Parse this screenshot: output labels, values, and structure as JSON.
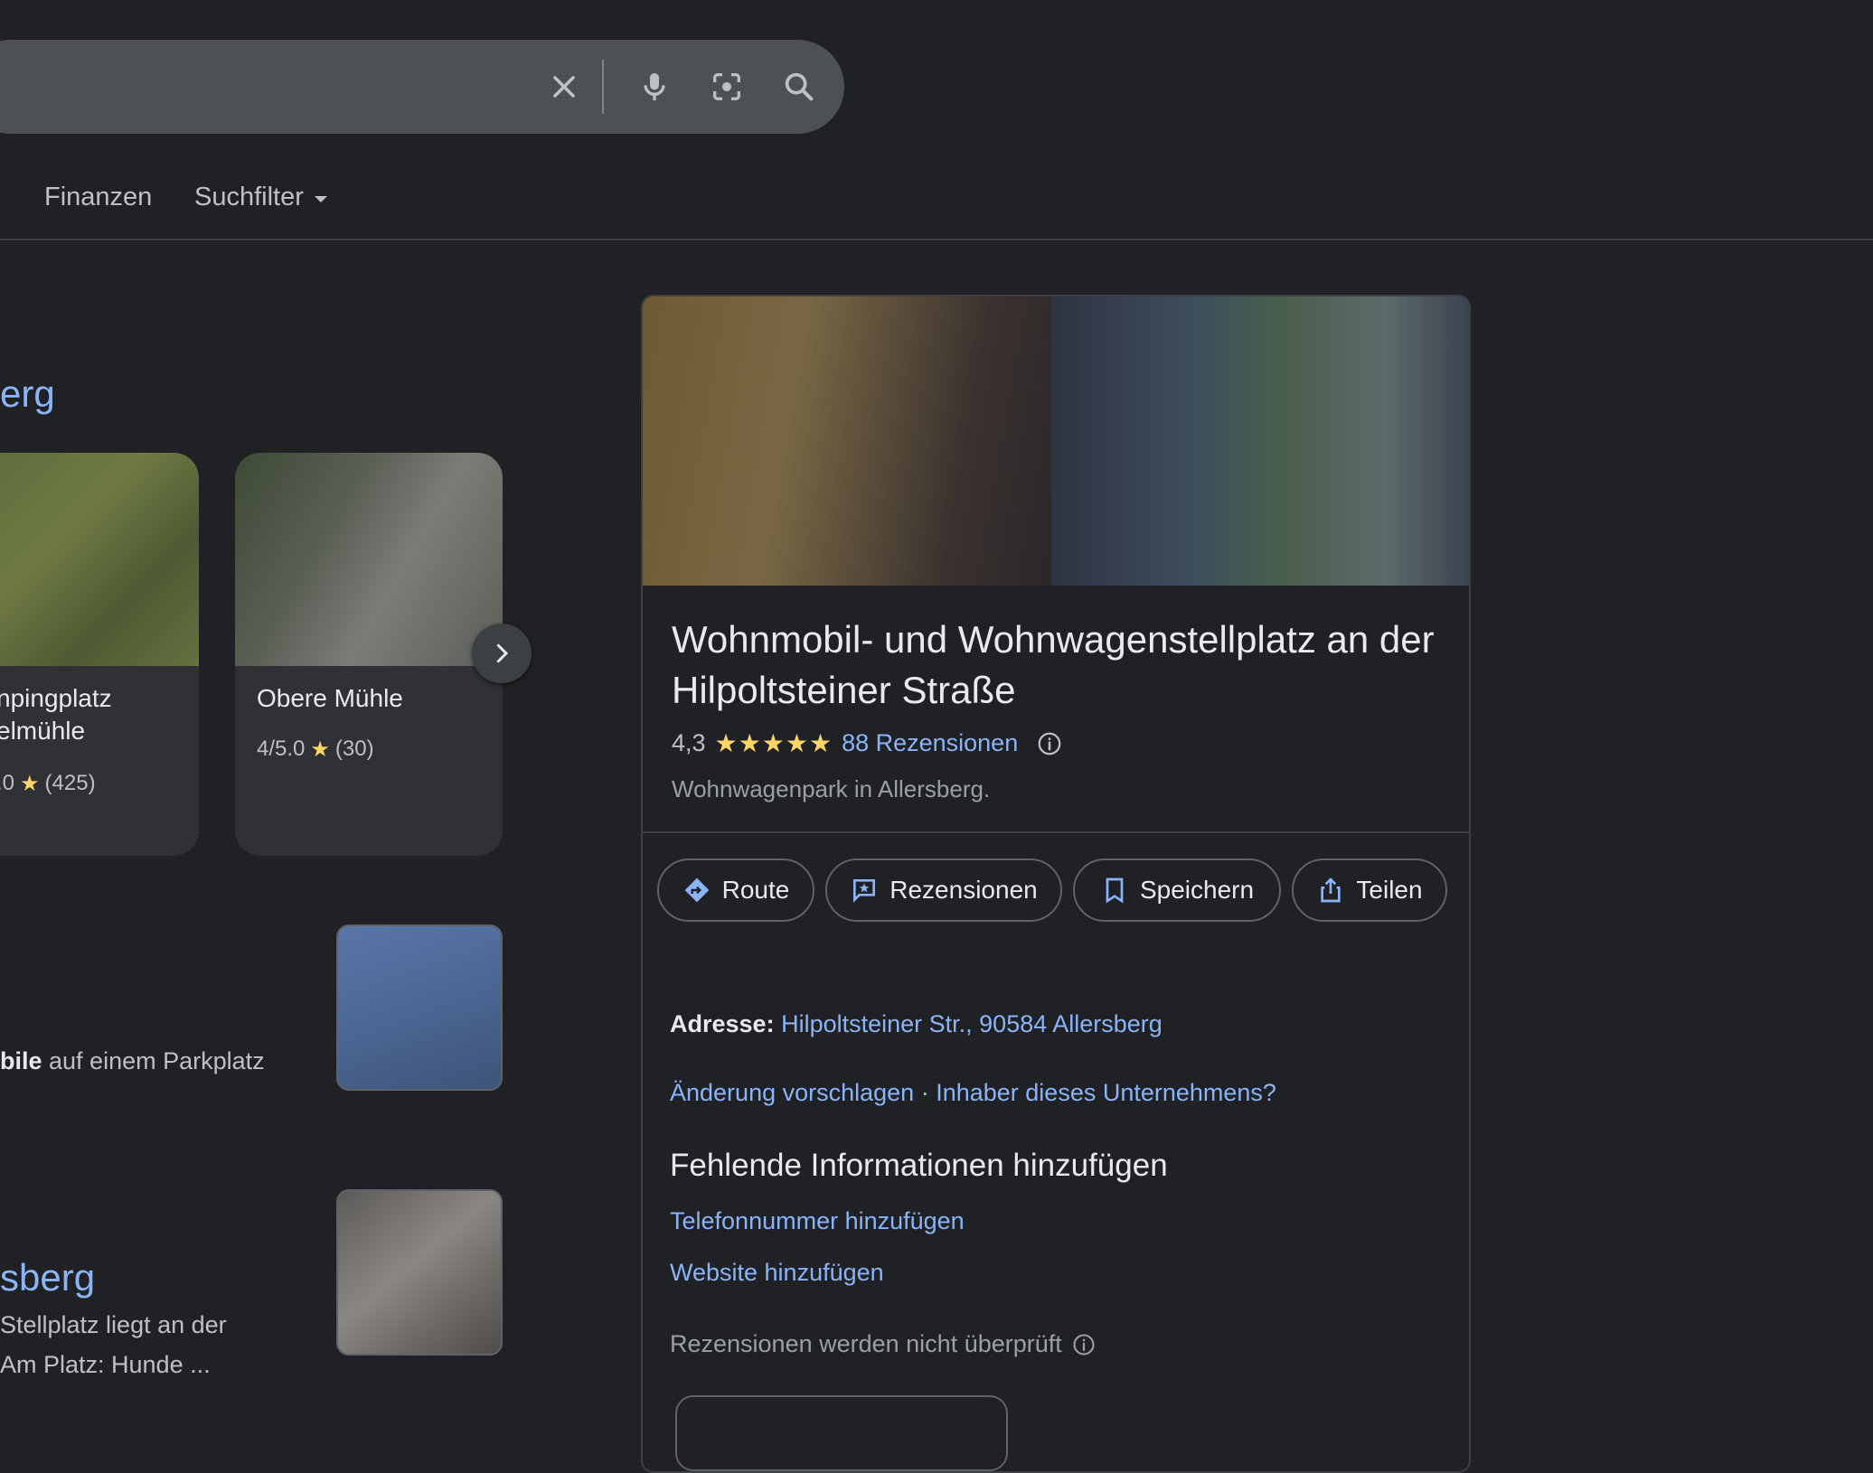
{
  "search": {
    "value": ""
  },
  "tabs": {
    "finance": "Finanzen",
    "filter": "Suchfilter"
  },
  "left": {
    "heading_fragment": "erg",
    "cards": [
      {
        "title_line1": "npingplatz",
        "title_line2": "elmühle",
        "rating": ".0",
        "count": "(425)"
      },
      {
        "title": "Obere Mühle",
        "rating": "4/5.0",
        "count": "(30)"
      }
    ],
    "result1_snippet_bold": "bile",
    "result1_snippet": " auf einem Parkplatz",
    "result2_title": "sberg",
    "result2_line1": "Stellplatz liegt an der",
    "result2_line2": "Am Platz: Hunde ..."
  },
  "panel": {
    "title": "Wohnmobil- und Wohnwagenstellplatz an der Hilpoltsteiner Straße",
    "rating": "4,3",
    "rating_value": 4.3,
    "stars": "★★★★★",
    "reviews_link": "88 Rezensionen",
    "subtitle": "Wohnwagenpark in Allersberg.",
    "actions": {
      "route": "Route",
      "reviews": "Rezensionen",
      "save": "Speichern",
      "share": "Teilen"
    },
    "address_label": "Adresse:",
    "address_value": "Hilpoltsteiner Str., 90584 Allersberg",
    "suggest_edit": "Änderung vorschlagen",
    "separator": "·",
    "owner": "Inhaber dieses Unternehmens?",
    "missing_heading": "Fehlende Informationen hinzufügen",
    "add_phone": "Telefonnummer hinzufügen",
    "add_website": "Website hinzufügen",
    "reviews_note": "Rezensionen werden nicht überprüft"
  },
  "colors": {
    "background": "#202124",
    "link": "#8ab4f8",
    "star": "#fdd663",
    "card": "#303134"
  }
}
